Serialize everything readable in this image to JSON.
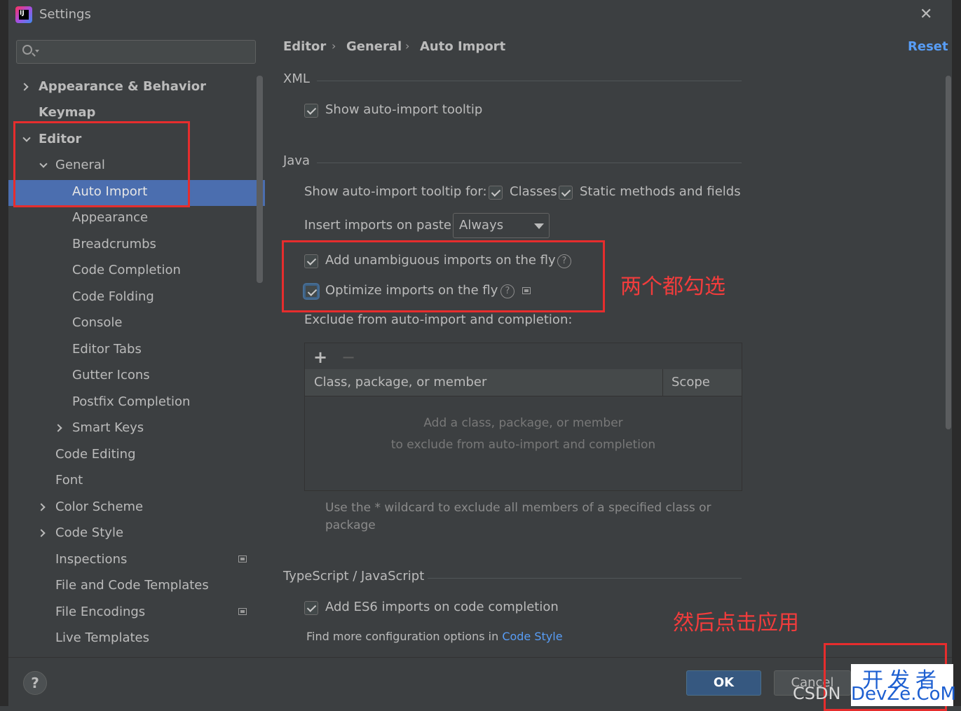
{
  "window": {
    "title": "Settings"
  },
  "search": {
    "placeholder": ""
  },
  "sidebar": {
    "items": [
      {
        "label": "Appearance & Behavior"
      },
      {
        "label": "Keymap"
      },
      {
        "label": "Editor"
      },
      {
        "label": "General"
      },
      {
        "label": "Auto Import"
      },
      {
        "label": "Appearance"
      },
      {
        "label": "Breadcrumbs"
      },
      {
        "label": "Code Completion"
      },
      {
        "label": "Code Folding"
      },
      {
        "label": "Console"
      },
      {
        "label": "Editor Tabs"
      },
      {
        "label": "Gutter Icons"
      },
      {
        "label": "Postfix Completion"
      },
      {
        "label": "Smart Keys"
      },
      {
        "label": "Code Editing"
      },
      {
        "label": "Font"
      },
      {
        "label": "Color Scheme"
      },
      {
        "label": "Code Style"
      },
      {
        "label": "Inspections"
      },
      {
        "label": "File and Code Templates"
      },
      {
        "label": "File Encodings"
      },
      {
        "label": "Live Templates"
      }
    ]
  },
  "breadcrumb": {
    "items": [
      "Editor",
      "General",
      "Auto Import"
    ],
    "separator": "›",
    "reset_label": "Reset"
  },
  "xml": {
    "title": "XML",
    "show_tooltip_label": "Show auto-import tooltip"
  },
  "java": {
    "title": "Java",
    "tooltip_for_label": "Show auto-import tooltip for:",
    "classes_label": "Classes",
    "static_label": "Static methods and fields",
    "insert_label": "Insert imports on paste:",
    "insert_value": "Always",
    "unambiguous_label": "Add unambiguous imports on the fly",
    "optimize_label": "Optimize imports on the fly",
    "exclude_label": "Exclude from auto-import and completion:",
    "table": {
      "add": "+",
      "remove": "−",
      "col1": "Class, package, or member",
      "col2": "Scope",
      "empty_line1": "Add a class, package, or member",
      "empty_line2": "to exclude from auto-import and completion"
    },
    "hint_line1": "Use the * wildcard to exclude all members of a specified class or",
    "hint_line2": "package"
  },
  "ts": {
    "title": "TypeScript / JavaScript",
    "es6_label": "Add ES6 imports on code completion",
    "more_prefix": "Find more configuration options in",
    "more_link": "Code Style"
  },
  "footer": {
    "help": "?",
    "ok": "OK",
    "cancel": "Cancel"
  },
  "annotations": {
    "both_check": "两个都勾选",
    "then_apply": "然后点击应用"
  },
  "watermark": {
    "line1": "开发者",
    "line2": "DevZe.CoM",
    "csdn": "CSDN"
  },
  "colors": {
    "selected": "#4b6eaf",
    "link": "#589df6",
    "annotation": "#e62d2d",
    "ok_button": "#365880"
  }
}
